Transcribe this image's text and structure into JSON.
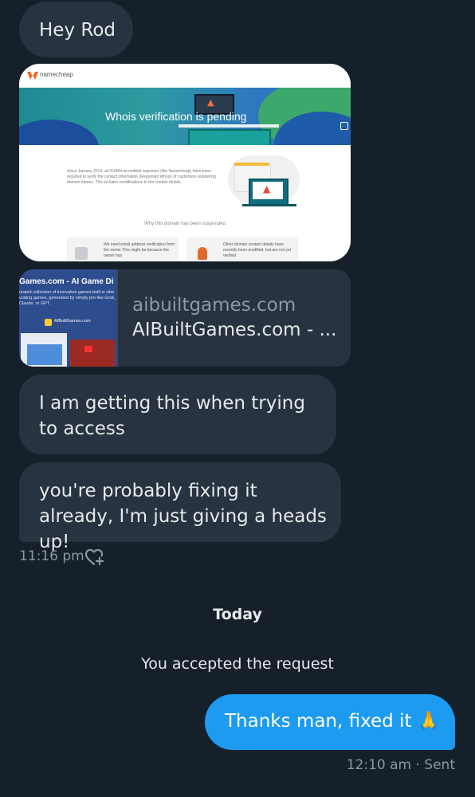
{
  "messages": {
    "greeting": "Hey Rod",
    "access_issue": "I am getting this when trying to access",
    "fixing_note": "you're probably fixing it already, I'm just giving a heads up!",
    "received_time": "11:16 pm",
    "outgoing": "Thanks man, fixed it 🙏",
    "outgoing_meta": "12:10 am · Sent"
  },
  "image_attachment": {
    "brand": "namecheap",
    "hero_title": "Whois verification is pending",
    "body_text": "Since January 2014, all ICANN accredited registrars (like Namecheap) have been required to verify the contact information (Registrant Whois) of customers registering domain names. This includes modifications to the contact details.",
    "why_heading": "Why this domain has been suspended",
    "reason_1": "We need email address verification from the owner This might be because the owner has",
    "reason_2": "Other domain contact details have recently been modified, but are not yet verified"
  },
  "link_preview": {
    "thumb_title": "Games.com - AI Game Di",
    "thumb_desc": "urated collection of innovative games built w vibe coding games, generated by simply pro like Grok, Claude, or GPT.",
    "thumb_brand": "AIBuiltGames.com",
    "domain": "aibuiltgames.com",
    "title": "AIBuiltGames.com - ..."
  },
  "day_separator": "Today",
  "system_message": "You accepted the request",
  "colors": {
    "background": "#15202b",
    "incoming_bubble": "#273340",
    "outgoing_bubble": "#1d9bf0",
    "muted_text": "#8b98a5"
  },
  "icons": {
    "reaction": "heart-plus-icon"
  }
}
